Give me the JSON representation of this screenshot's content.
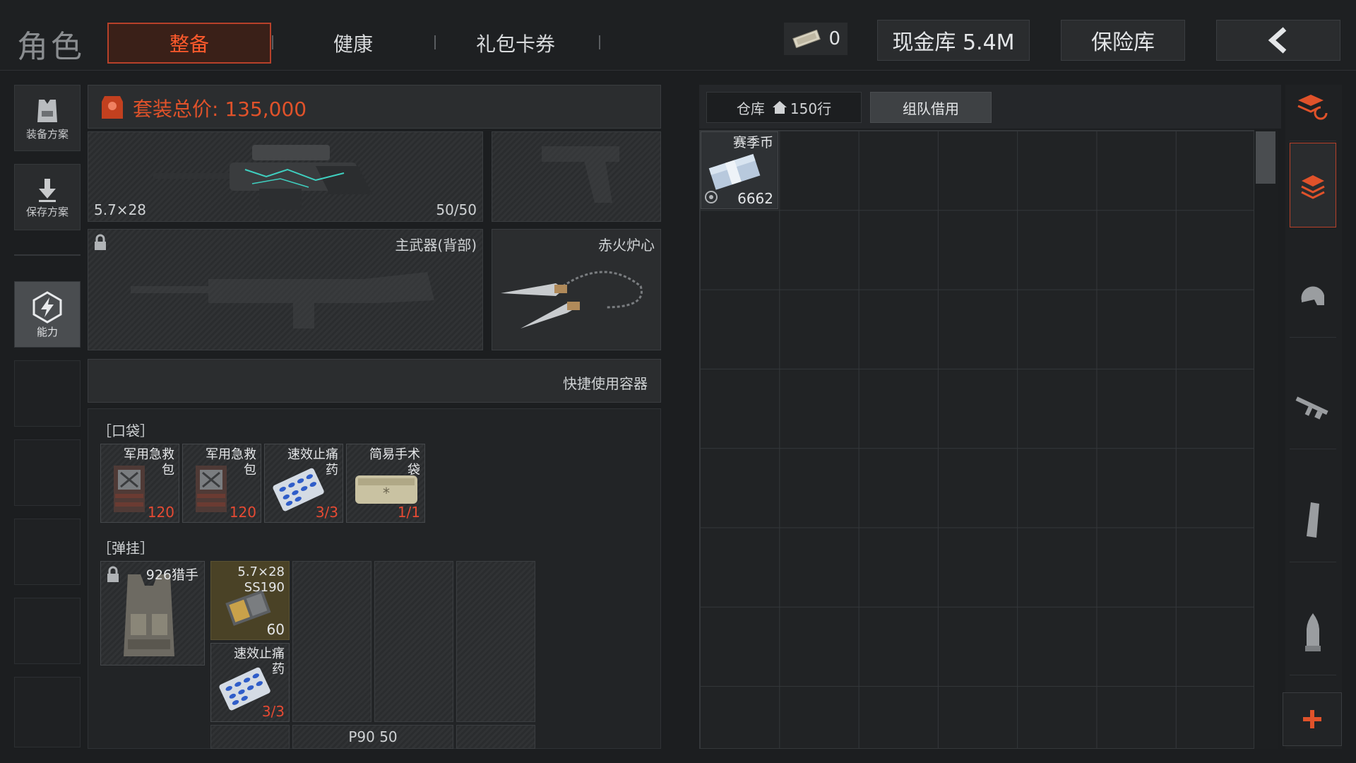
{
  "header": {
    "title": "角色",
    "tabs": [
      {
        "label": "整备",
        "active": true
      },
      {
        "label": "健康"
      },
      {
        "label": "礼包卡券"
      }
    ],
    "coin_count": "0",
    "cash_vault": "现金库 5.4M",
    "safe_label": "保险库",
    "back_icon": "chevron-left-icon"
  },
  "left_rail": {
    "items": [
      {
        "label": "装备方案",
        "icon": "vest-icon"
      },
      {
        "label": "保存方案",
        "icon": "download-icon"
      },
      {
        "label": "能力",
        "icon": "lightning-hex-icon"
      }
    ]
  },
  "loadout": {
    "suit_total": "套装总价: 135,000",
    "primary": {
      "caliber": "5.7×28",
      "ammo": "50/50"
    },
    "secondary_slot_label": "主武器(背部)",
    "melee_label": "赤火炉心",
    "quick_container": "快捷使用容器",
    "pocket_label": "［口袋］",
    "pocket_items": [
      {
        "name": "军用急救\n包",
        "count": "120"
      },
      {
        "name": "军用急救\n包",
        "count": "120"
      },
      {
        "name": "速效止痛\n药",
        "count": "3/3"
      },
      {
        "name": "简易手术\n袋",
        "count": "1/1"
      }
    ],
    "rig_label": "［弹挂］",
    "rig": {
      "name": "926猎手"
    },
    "rig_items": [
      {
        "name": "5.7×28\nSS190",
        "count": "60"
      },
      {
        "name": "速效止痛\n药",
        "count": "3/3"
      }
    ],
    "mag_label": "P90 50"
  },
  "warehouse": {
    "tab_label": "仓库",
    "rows": "150行",
    "team_borrow": "组队借用",
    "items": [
      {
        "name": "赛季币",
        "count": "6662"
      }
    ]
  },
  "colors": {
    "accent": "#e0522a",
    "count_red": "#e64a33",
    "bg": "#1c1e20"
  }
}
